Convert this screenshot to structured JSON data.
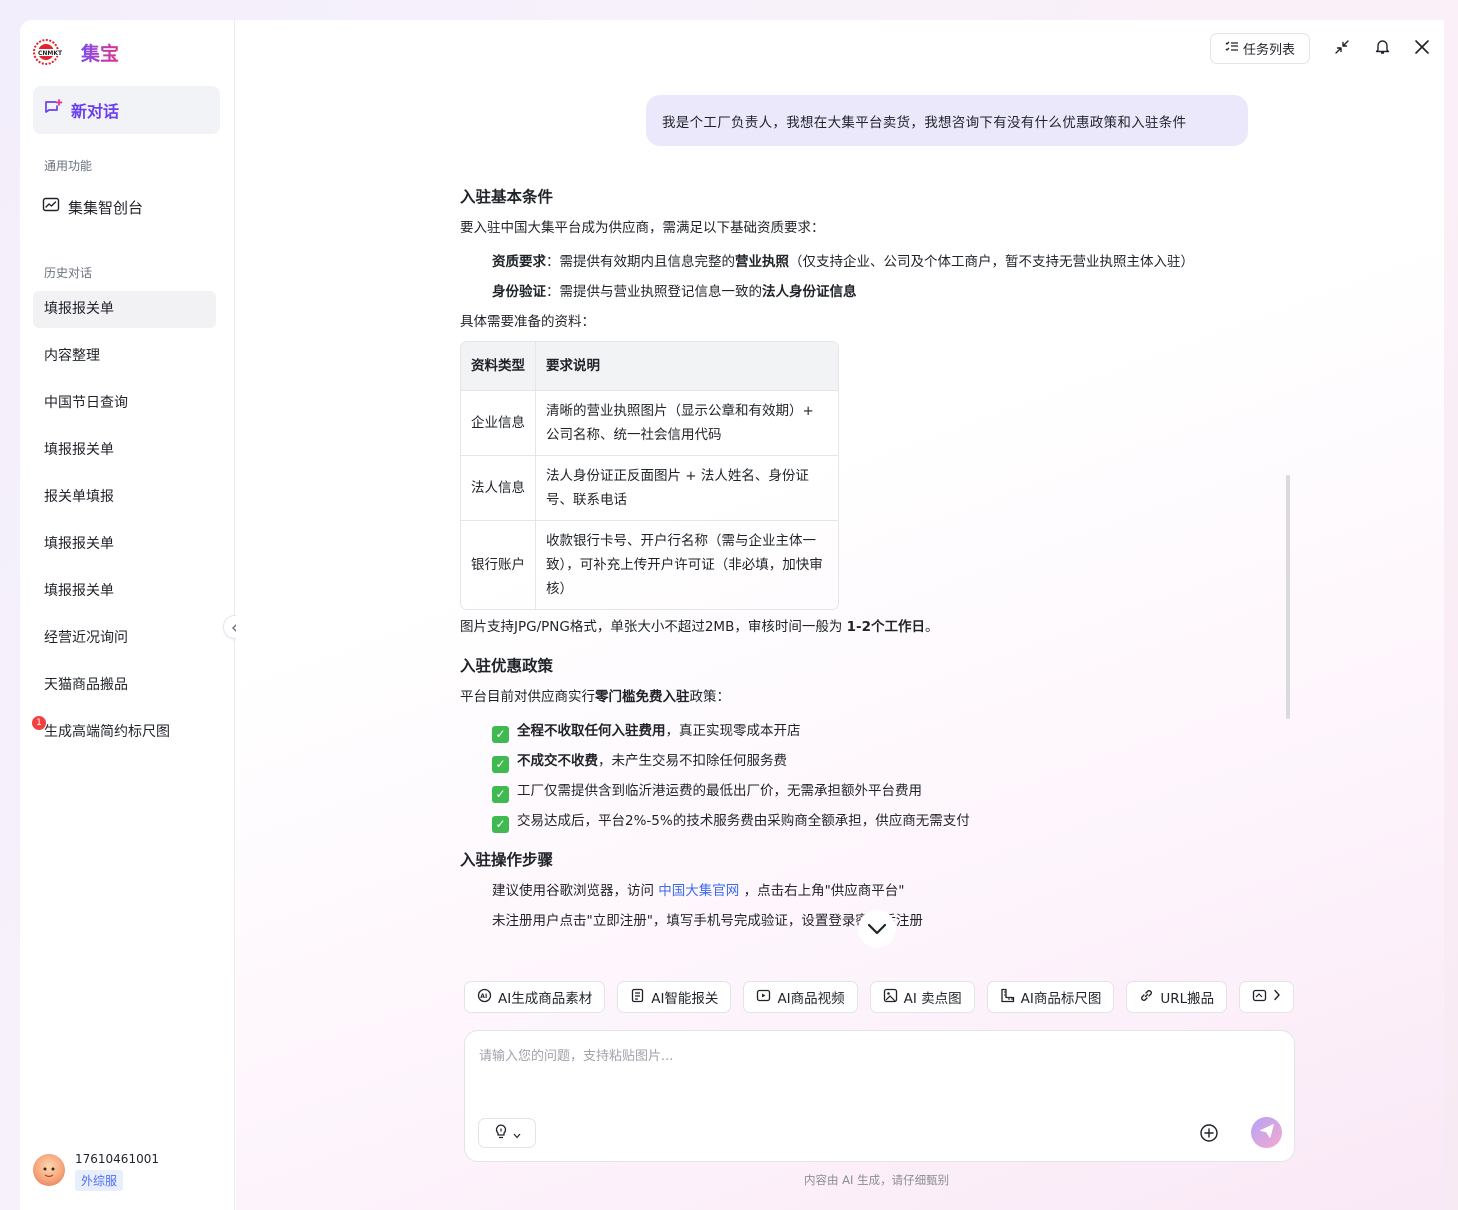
{
  "app": {
    "name": "集宝"
  },
  "sidebar": {
    "new_chat": "新对话",
    "general_title": "通用功能",
    "tools": [
      {
        "label": "集集智创台",
        "icon": "chart-icon"
      }
    ],
    "history_title": "历史对话",
    "history": [
      {
        "label": "填报报关单",
        "active": true
      },
      {
        "label": "内容整理"
      },
      {
        "label": "中国节日查询"
      },
      {
        "label": "填报报关单"
      },
      {
        "label": "报关单填报"
      },
      {
        "label": "填报报关单"
      },
      {
        "label": "填报报关单"
      },
      {
        "label": "经营近况询问"
      },
      {
        "label": "天猫商品搬品"
      },
      {
        "label": "生成高端简约标尺图",
        "badge": "1"
      }
    ],
    "user": {
      "name": "17610461001",
      "tag": "外综服"
    }
  },
  "topbar": {
    "task_list": "任务列表"
  },
  "chat": {
    "user_message": "我是个工厂负责人，我想在大集平台卖货，我想咨询下有没有什么优惠政策和入驻条件",
    "answer": {
      "s1_title": "入驻基本条件",
      "s1_intro": "要入驻中国大集平台成为供应商，需满足以下基础资质要求：",
      "req1_label": "资质要求",
      "req1_text_a": "：需提供有效期内且信息完整的",
      "req1_bold": "营业执照",
      "req1_text_b": "（仅支持企业、公司及个体工商户，暂不支持无营业执照主体入驻）",
      "req2_label": "身份验证",
      "req2_text": "：需提供与营业执照登记信息一致的",
      "req2_bold": "法人身份证信息",
      "materials_intro": "具体需要准备的资料：",
      "table": {
        "headers": [
          "资料类型",
          "要求说明"
        ],
        "rows": [
          [
            "企业信息",
            "清晰的营业执照图片（显示公章和有效期）+ 公司名称、统一社会信用代码"
          ],
          [
            "法人信息",
            "法人身份证正反面图片 + 法人姓名、身份证号、联系电话"
          ],
          [
            "银行账户",
            "收款银行卡号、开户行名称（需与企业主体一致），可补充上传开户许可证（非必填，加快审核）"
          ]
        ]
      },
      "img_note_a": "图片支持JPG/PNG格式，单张大小不超过2MB，审核时间一般为 ",
      "img_note_bold": "1-2个工作日",
      "img_note_b": "。",
      "s2_title": "入驻优惠政策",
      "s2_intro_a": "平台目前对供应商实行",
      "s2_intro_bold": "零门槛免费入驻",
      "s2_intro_b": "政策：",
      "benefits": [
        {
          "bold": "全程不收取任何入驻费用",
          "text": "，真正实现零成本开店"
        },
        {
          "bold": "不成交不收费",
          "text": "，未产生交易不扣除任何服务费"
        },
        {
          "bold": "",
          "text": "工厂仅需提供含到临沂港运费的最低出厂价，无需承担额外平台费用"
        },
        {
          "bold": "",
          "text": "交易达成后，平台2%-5%的技术服务费由采购商全额承担，供应商无需支付"
        }
      ],
      "check_mark": "✓",
      "s3_title": "入驻操作步骤",
      "step1_a": "建议使用谷歌浏览器，访问 ",
      "step1_link": "中国大集官网",
      "step1_b": " ，点击右上角\"供应商平台\"",
      "step2": "未注册用户点击\"立即注册\"，填写手机号完成验证，设置登录密码后注册"
    }
  },
  "chips": [
    {
      "label": "AI生成商品素材",
      "icon": "ai-icon"
    },
    {
      "label": "AI智能报关",
      "icon": "document-icon"
    },
    {
      "label": "AI商品视频",
      "icon": "video-icon"
    },
    {
      "label": "AI 卖点图",
      "icon": "image-icon"
    },
    {
      "label": "AI商品标尺图",
      "icon": "ruler-icon"
    },
    {
      "label": "URL搬品",
      "icon": "link-icon"
    }
  ],
  "input": {
    "placeholder": "请输入您的问题，支持粘贴图片..."
  },
  "footer": {
    "disclaimer": "内容由 AI 生成，请仔细甄别"
  }
}
